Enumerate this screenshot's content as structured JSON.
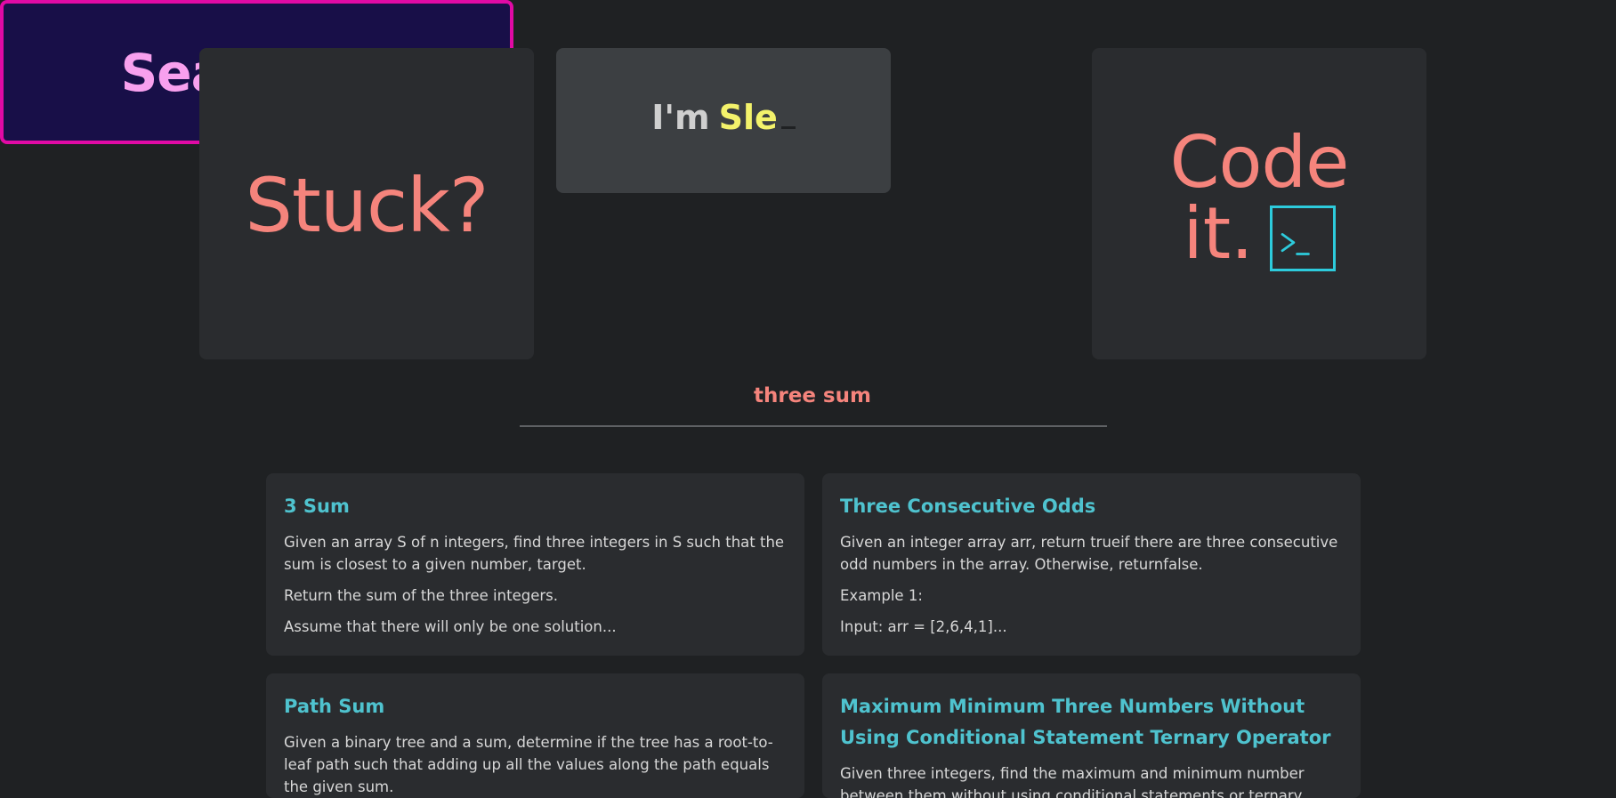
{
  "hero": {
    "stuck": "Stuck?",
    "im_prefix": "I'm",
    "im_typed": "Sle",
    "search": "Search It.",
    "code_line1": "Code",
    "code_line2": "it.",
    "terminal_glyph": ">_"
  },
  "search": {
    "query": "three sum"
  },
  "results": [
    {
      "title": "3 Sum",
      "lines": [
        "Given an array S of n integers, find three integers in S such that the sum is closest to a given number, target.",
        "Return the sum of the three integers.",
        "Assume that there will only be one solution..."
      ]
    },
    {
      "title": "Three Consecutive Odds",
      "lines": [
        "Given an integer array arr, return trueif there are three consecutive odd numbers in the array. Otherwise, returnfalse.",
        "Example 1:",
        "Input: arr = [2,6,4,1]..."
      ]
    },
    {
      "title": "Path Sum",
      "lines": [
        "Given a binary tree and a sum, determine if the tree has a root-to-leaf path such that adding up all the values along the path equals the given sum."
      ]
    },
    {
      "title": "Maximum Minimum Three Numbers Without Using Conditional Statement Ternary Operator",
      "lines": [
        "Given three integers, find the maximum and minimum number between them without using conditional statements or ternary operator."
      ]
    }
  ],
  "colors": {
    "background": "#1f2123",
    "card": "#2a2c2f",
    "accent_salmon": "#f5847c",
    "accent_cyan": "#4fc3cf",
    "accent_magenta": "#e10aa5",
    "typed_yellow": "#f3f26b"
  }
}
